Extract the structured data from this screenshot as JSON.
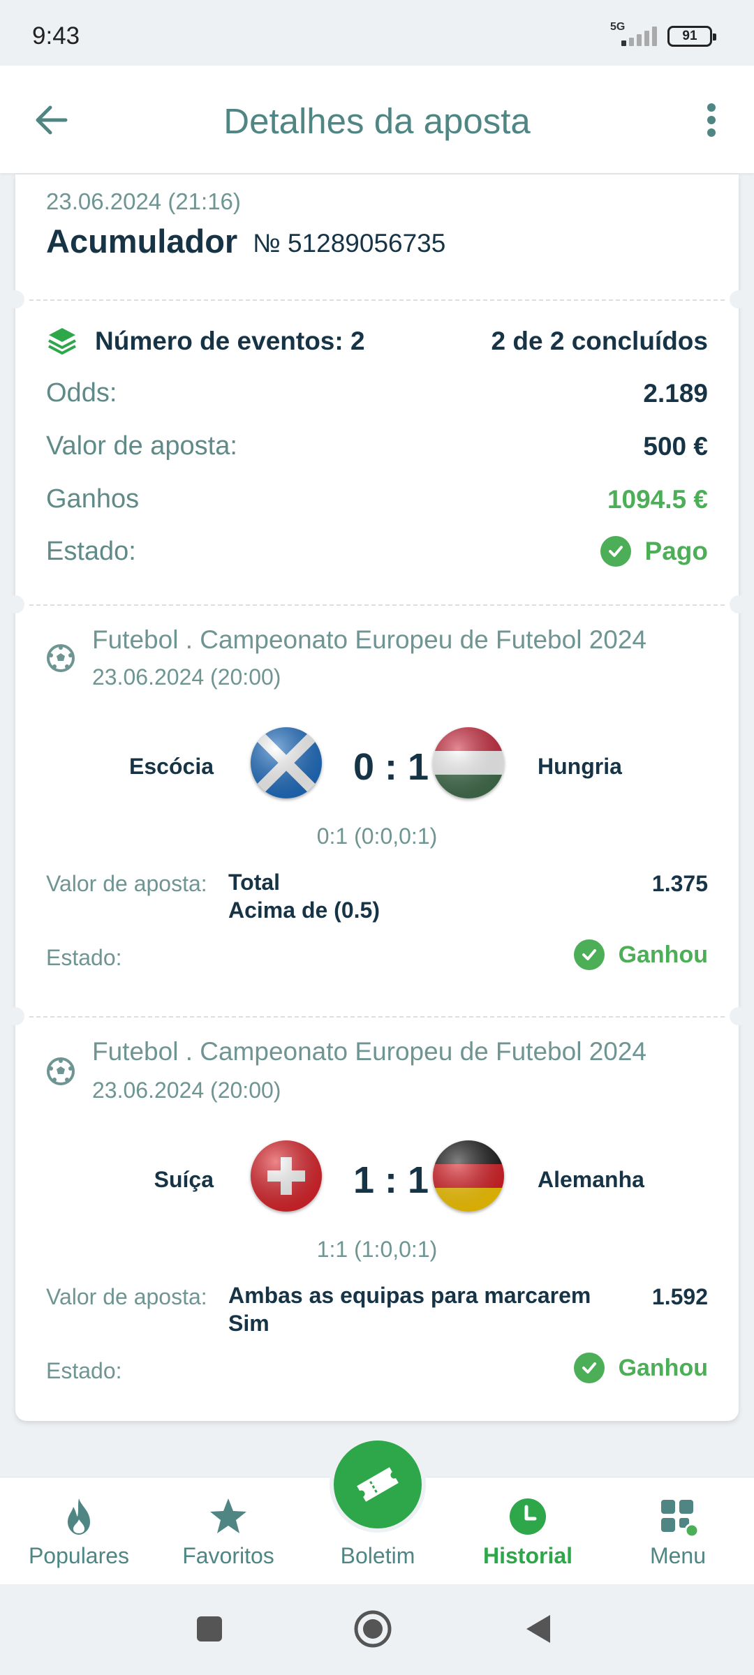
{
  "status_bar": {
    "time": "9:43",
    "network": "5G",
    "battery": "91"
  },
  "header": {
    "title": "Detalhes da aposta"
  },
  "ticket": {
    "datetime": "23.06.2024 (21:16)",
    "type": "Acumulador",
    "number": "№ 51289056735"
  },
  "summary": {
    "events_label": "Número de eventos: 2",
    "events_status": "2 de 2 concluídos",
    "odds_label": "Odds:",
    "odds_value": "2.189",
    "stake_label": "Valor de aposta:",
    "stake_value": "500 €",
    "winnings_label": "Ganhos",
    "winnings_value": "1094.5 €",
    "state_label": "Estado:",
    "state_value": "Pago"
  },
  "events": [
    {
      "league": "Futebol . Campeonato Europeu de Futebol 2024",
      "date": "23.06.2024 (20:00)",
      "home": "Escócia",
      "away": "Hungria",
      "score": "0 : 1",
      "detail": "0:1 (0:0,0:1)",
      "bet_label": "Valor de aposta:",
      "bet_line1": "Total",
      "bet_line2": "Acima de (0.5)",
      "odd": "1.375",
      "state_label": "Estado:",
      "state": "Ganhou"
    },
    {
      "league": "Futebol . Campeonato Europeu de Futebol 2024",
      "date": "23.06.2024 (20:00)",
      "home": "Suíça",
      "away": "Alemanha",
      "score": "1 : 1",
      "detail": "1:1 (1:0,0:1)",
      "bet_label": "Valor de aposta:",
      "bet_line1": "Ambas as equipas para marcarem",
      "bet_line2": "Sim",
      "odd": "1.592",
      "state_label": "Estado:",
      "state": "Ganhou"
    }
  ],
  "nav": {
    "populares": "Populares",
    "favoritos": "Favoritos",
    "boletim": "Boletim",
    "historial": "Historial",
    "menu": "Menu"
  },
  "colors": {
    "accent": "#4f8684",
    "green": "#4cae57",
    "dark": "#173447"
  }
}
